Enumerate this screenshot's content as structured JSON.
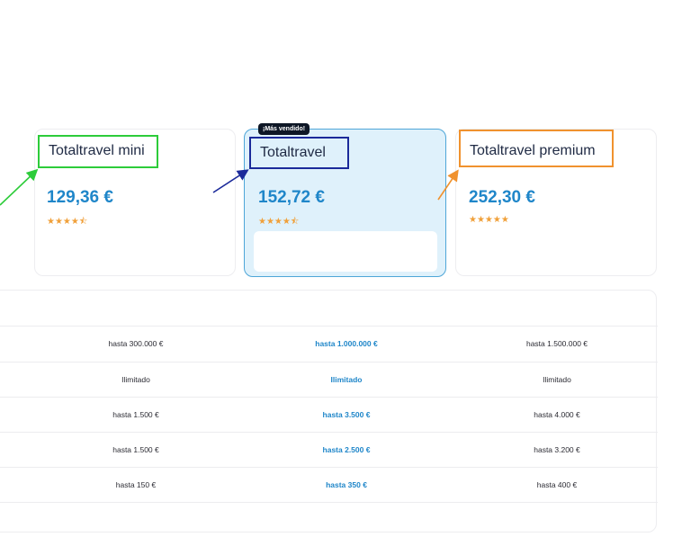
{
  "colors": {
    "accent": "#1f86c9",
    "mini_box": "#2dcc3a",
    "standard_box": "#1b2a9a",
    "premium_box": "#f0922e",
    "stars": "#f0a03a",
    "featured_bg": "#dff1fb"
  },
  "plans": {
    "mini": {
      "name": "Totaltravel mini",
      "price": "129,36 €",
      "rating_stars": 4.5,
      "stars_text": "★★★★⯪"
    },
    "standard": {
      "badge": "¡Más vendido!",
      "name": "Totaltravel",
      "price": "152,72 €",
      "rating_stars": 4.5,
      "stars_text": "★★★★⯪"
    },
    "premium": {
      "name": "Totaltravel premium",
      "price": "252,30 €",
      "rating_stars": 5,
      "stars_text": "★★★★★"
    }
  },
  "table": {
    "rows": [
      {
        "mini": "hasta 300.000 €",
        "standard": "hasta 1.000.000 €",
        "premium": "hasta 1.500.000 €"
      },
      {
        "mini": "Ilimitado",
        "standard": "Ilimitado",
        "premium": "Ilimitado"
      },
      {
        "mini": "hasta 1.500 €",
        "standard": "hasta 3.500 €",
        "premium": "hasta 4.000 €"
      },
      {
        "mini": "hasta 1.500 €",
        "standard": "hasta 2.500 €",
        "premium": "hasta 3.200 €"
      },
      {
        "mini": "hasta 150 €",
        "standard": "hasta 350 €",
        "premium": "hasta 400 €"
      }
    ]
  }
}
